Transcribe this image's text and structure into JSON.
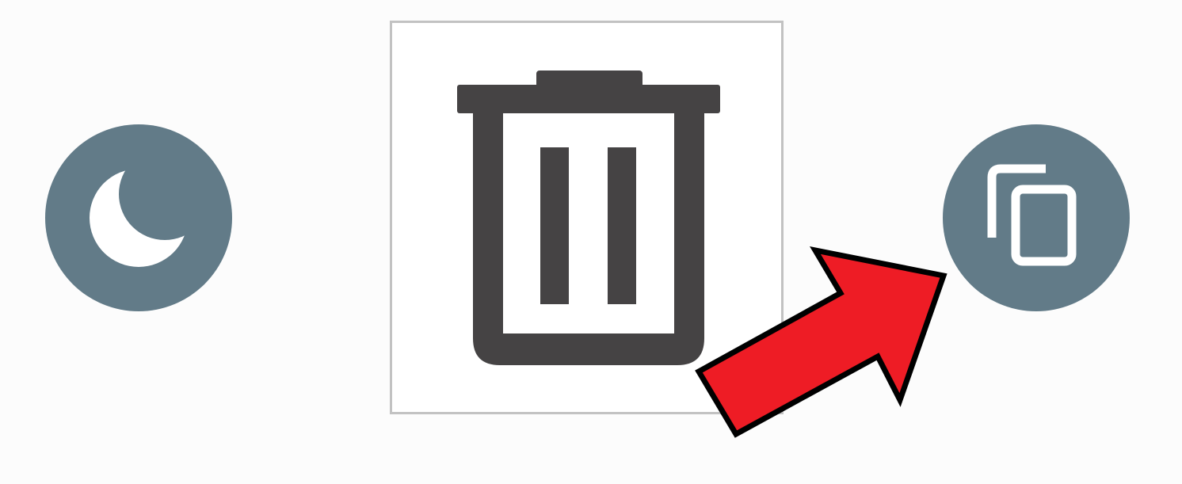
{
  "toolbar": {
    "items": [
      {
        "icon": "moon-icon",
        "role": "night-mode-button"
      },
      {
        "icon": "trash-icon",
        "role": "delete-button",
        "state": "highlighted"
      },
      {
        "icon": "copy-icon",
        "role": "copy-button"
      }
    ]
  },
  "annotation": {
    "type": "arrow",
    "points_to": "copy-button",
    "color": "#ee1c25"
  },
  "colors": {
    "button_fill": "#627b88",
    "icon_fg": "#ffffff",
    "trash_icon": "#454344",
    "tile_border": "#c2c2c2",
    "background": "#fcfcfc"
  }
}
